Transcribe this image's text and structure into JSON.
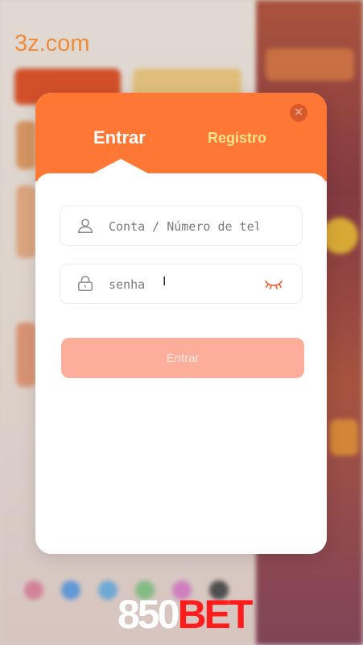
{
  "site": {
    "domain": "3z.com"
  },
  "modal": {
    "tabs": [
      {
        "label": "Entrar",
        "active": true
      },
      {
        "label": "Registro",
        "active": false
      }
    ],
    "close_icon": "close-icon",
    "account": {
      "placeholder": "Conta / Número de telefone",
      "value": "",
      "icon": "user-icon"
    },
    "password": {
      "placeholder": "senha",
      "value": "",
      "icon": "lock-icon",
      "toggle_icon": "eye-closed-icon"
    },
    "submit_label": "Entrar"
  },
  "brand": {
    "number": "850",
    "word": "BET"
  },
  "colors": {
    "accent": "#fe7735",
    "register_tab": "#ffe38a",
    "submit_disabled": "#fdae9b",
    "brand_red": "#ff1c1c"
  }
}
